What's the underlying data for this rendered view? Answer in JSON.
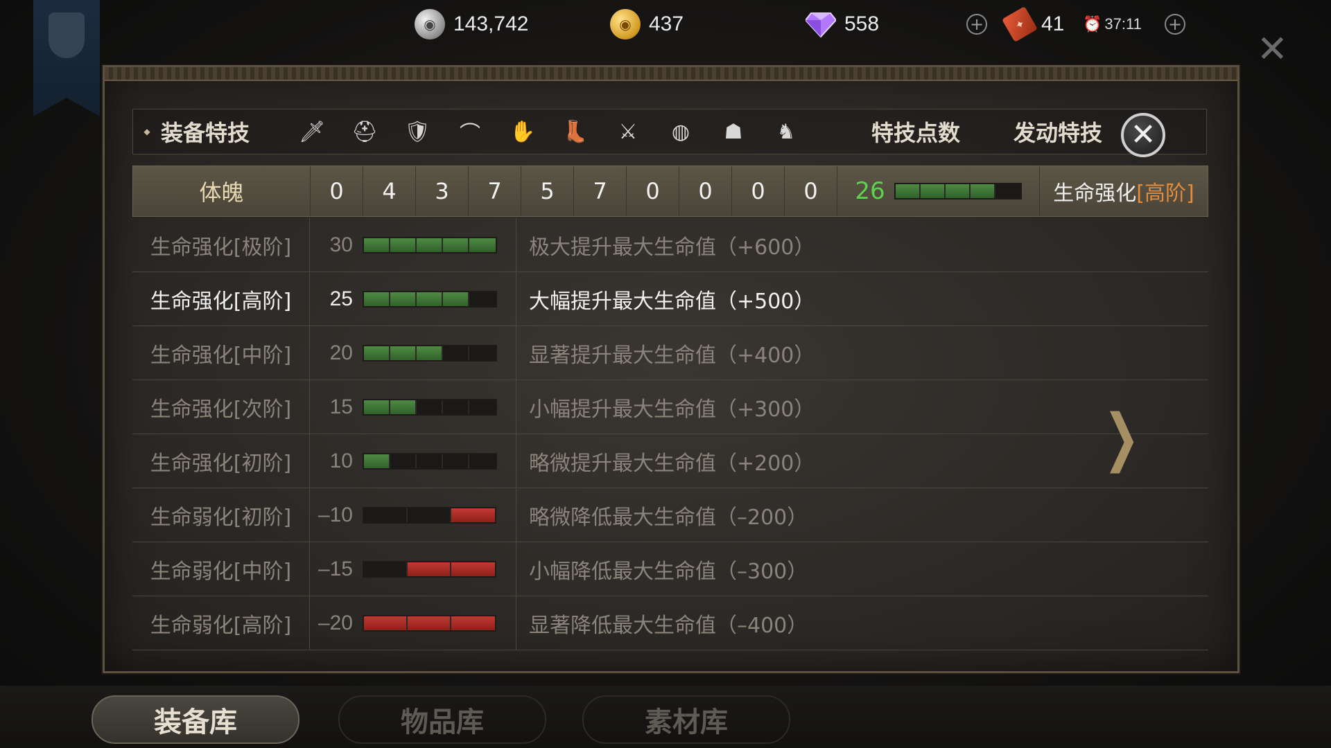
{
  "resources": {
    "silver": "143,742",
    "gold": "437",
    "diamond": "558",
    "tickets": "41",
    "timer": "37:11"
  },
  "header": {
    "title": "装备特技",
    "points_label": "特技点数",
    "active_label": "发动特技",
    "slot_icons": [
      "sword-icon",
      "helmet-icon",
      "armor-icon",
      "shoulder-icon",
      "glove-icon",
      "boots-icon",
      "ring-icon",
      "amulet-icon",
      "mask-icon",
      "horse-icon"
    ]
  },
  "summary": {
    "name": "体魄",
    "values": [
      "0",
      "4",
      "3",
      "7",
      "5",
      "7",
      "0",
      "0",
      "0",
      "0"
    ],
    "points": "26",
    "points_bar": [
      "g",
      "g",
      "g",
      "g",
      "e"
    ],
    "active_prefix": "生命强化",
    "active_level": "[高阶]"
  },
  "levels": [
    {
      "name": "生命强化[极阶]",
      "value": "30",
      "bar": [
        "g",
        "g",
        "g",
        "g",
        "g"
      ],
      "desc": "极大提升最大生命值（+600）",
      "state": "dim"
    },
    {
      "name": "生命强化[高阶]",
      "value": "25",
      "bar": [
        "g",
        "g",
        "g",
        "g",
        "e"
      ],
      "desc": "大幅提升最大生命值（+500）",
      "state": "hl"
    },
    {
      "name": "生命强化[中阶]",
      "value": "20",
      "bar": [
        "g",
        "g",
        "g",
        "e",
        "e"
      ],
      "desc": "显著提升最大生命值（+400）",
      "state": "dim"
    },
    {
      "name": "生命强化[次阶]",
      "value": "15",
      "bar": [
        "g",
        "g",
        "e",
        "e",
        "e"
      ],
      "desc": "小幅提升最大生命值（+300）",
      "state": "dim"
    },
    {
      "name": "生命强化[初阶]",
      "value": "10",
      "bar": [
        "g",
        "e",
        "e",
        "e",
        "e"
      ],
      "desc": "略微提升最大生命值（+200）",
      "state": "dim"
    },
    {
      "name": "生命弱化[初阶]",
      "value": "–10",
      "bar": [
        "e",
        "e",
        "r"
      ],
      "desc": "略微降低最大生命值（–200）",
      "state": "dim"
    },
    {
      "name": "生命弱化[中阶]",
      "value": "–15",
      "bar": [
        "e",
        "r",
        "r"
      ],
      "desc": "小幅降低最大生命值（–300）",
      "state": "dim"
    },
    {
      "name": "生命弱化[高阶]",
      "value": "–20",
      "bar": [
        "r",
        "r",
        "r"
      ],
      "desc": "显著降低最大生命值（–400）",
      "state": "dim"
    }
  ],
  "tabs": [
    {
      "label": "装备库",
      "active": true
    },
    {
      "label": "物品库",
      "active": false
    },
    {
      "label": "素材库",
      "active": false
    }
  ]
}
